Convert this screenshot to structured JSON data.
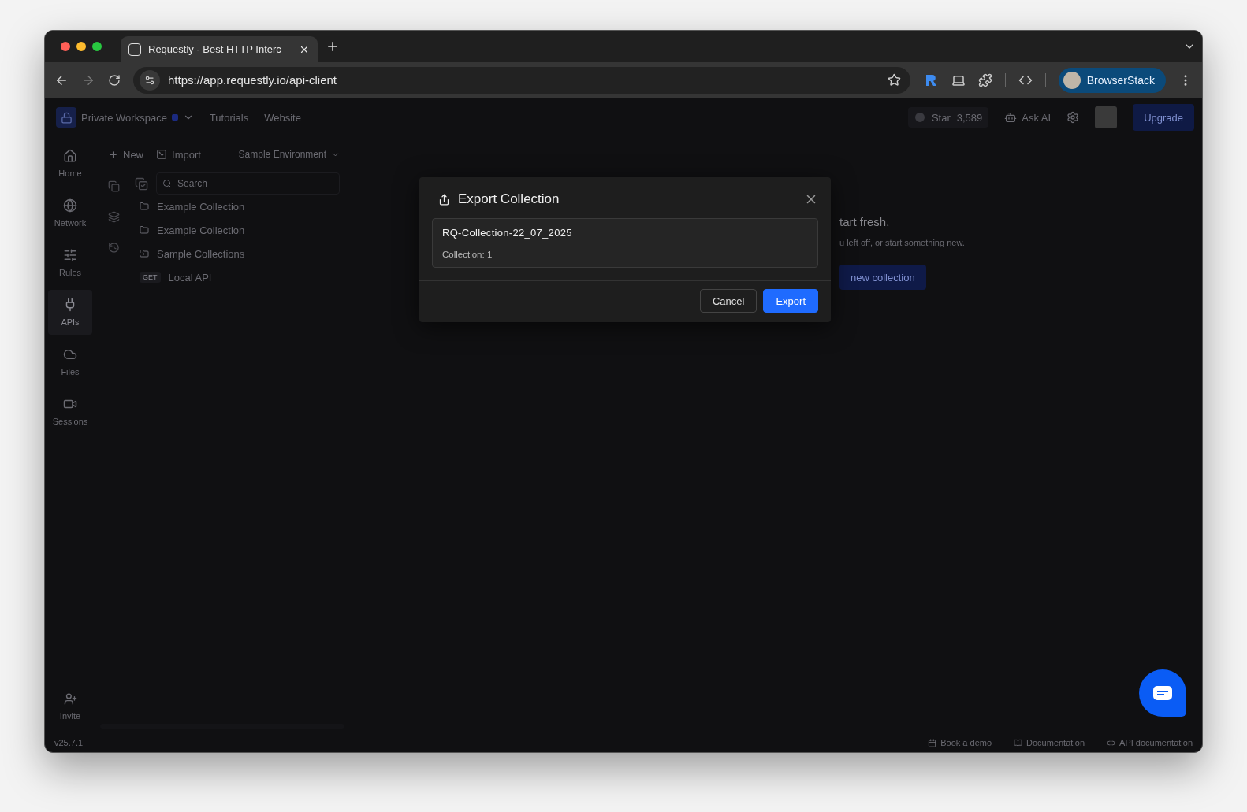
{
  "browser": {
    "tab_title": "Requestly - Best HTTP Interc",
    "url": "https://app.requestly.io/api-client",
    "profile": "BrowserStack"
  },
  "header": {
    "workspace": "Private Workspace",
    "nav": [
      "Tutorials",
      "Website"
    ],
    "star_label": "Star",
    "star_count": "3,589",
    "ask_ai": "Ask AI",
    "upgrade": "Upgrade"
  },
  "rail": {
    "items": [
      {
        "kind": "home",
        "label": "Home",
        "selected": false
      },
      {
        "kind": "network",
        "label": "Network",
        "selected": false
      },
      {
        "kind": "rules",
        "label": "Rules",
        "selected": false
      },
      {
        "kind": "apis",
        "label": "APIs",
        "selected": true
      },
      {
        "kind": "files",
        "label": "Files",
        "selected": false
      },
      {
        "kind": "sessions",
        "label": "Sessions",
        "selected": false
      }
    ],
    "invite": "Invite",
    "version": "v25.7.1"
  },
  "panel": {
    "new": "New",
    "import": "Import",
    "environment": "Sample Environment",
    "search": {
      "placeholder": "Search"
    },
    "tree": [
      {
        "kind": "collection",
        "name": "Example Collection"
      },
      {
        "kind": "collection",
        "name": "Example Collection"
      },
      {
        "kind": "sample",
        "name": "Sample Collections"
      },
      {
        "kind": "request",
        "method": "GET",
        "name": "Local API"
      }
    ]
  },
  "empty_state": {
    "heading": "tart fresh.",
    "text": "u left off, or start something new.",
    "button": "new collection"
  },
  "footer": {
    "links": [
      {
        "kind": "demo",
        "label": "Book a demo"
      },
      {
        "kind": "docs",
        "label": "Documentation"
      },
      {
        "kind": "api",
        "label": "API documentation"
      }
    ]
  },
  "modal": {
    "title": "Export Collection",
    "file_name": "RQ-Collection-22_07_2025",
    "count": "Collection: 1",
    "buttons": [
      {
        "kind": "secondary",
        "label": "Cancel"
      },
      {
        "kind": "primary",
        "label": "Export"
      }
    ]
  }
}
